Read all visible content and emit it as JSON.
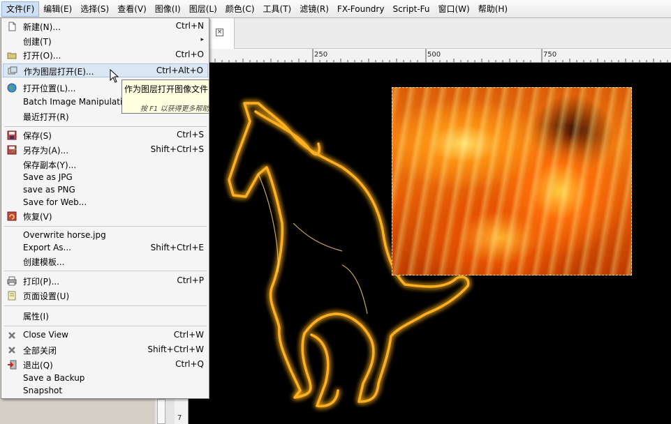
{
  "menubar": {
    "items": [
      {
        "label": "文件(F)"
      },
      {
        "label": "编辑(E)"
      },
      {
        "label": "选择(S)"
      },
      {
        "label": "查看(V)"
      },
      {
        "label": "图像(I)"
      },
      {
        "label": "图层(L)"
      },
      {
        "label": "颜色(C)"
      },
      {
        "label": "工具(T)"
      },
      {
        "label": "滤镜(R)"
      },
      {
        "label": "FX-Foundry"
      },
      {
        "label": "Script-Fu"
      },
      {
        "label": "窗口(W)"
      },
      {
        "label": "帮助(H)"
      }
    ]
  },
  "file_menu": {
    "items": [
      {
        "label": "新建(N)...",
        "shortcut": "Ctrl+N",
        "icon": "new-document-icon"
      },
      {
        "label": "创建(T)",
        "submenu": "▸"
      },
      {
        "label": "打开(O)...",
        "shortcut": "Ctrl+O",
        "icon": "folder-icon"
      },
      {
        "label": "作为图层打开(E)...",
        "shortcut": "Ctrl+Alt+O",
        "icon": "open-as-layer-icon"
      },
      {
        "label": "打开位置(L)...",
        "icon": "globe-icon"
      },
      {
        "label": "Batch Image Manipulation..."
      },
      {
        "label": "最近打开(R)"
      },
      {
        "label": "保存(S)",
        "shortcut": "Ctrl+S",
        "icon": "save-icon"
      },
      {
        "label": "另存为(A)...",
        "shortcut": "Shift+Ctrl+S",
        "icon": "save-as-icon"
      },
      {
        "label": "保存副本(Y)..."
      },
      {
        "label": "Save as JPG"
      },
      {
        "label": "save as PNG"
      },
      {
        "label": "Save for Web..."
      },
      {
        "label": "恢复(V)",
        "icon": "revert-icon"
      },
      {
        "label": "Overwrite horse.jpg"
      },
      {
        "label": "Export As...",
        "shortcut": "Shift+Ctrl+E"
      },
      {
        "label": "创建模板..."
      },
      {
        "label": "打印(P)...",
        "shortcut": "Ctrl+P",
        "icon": "printer-icon"
      },
      {
        "label": "页面设置(U)",
        "icon": "page-setup-icon"
      },
      {
        "label": "属性(I)"
      },
      {
        "label": "Close View",
        "shortcut": "Ctrl+W",
        "icon": "close-x-icon"
      },
      {
        "label": "全部关闭",
        "shortcut": "Shift+Ctrl+W",
        "icon": "close-all-icon"
      },
      {
        "label": "退出(Q)",
        "shortcut": "Ctrl+Q",
        "icon": "quit-icon"
      },
      {
        "label": "Save a Backup"
      },
      {
        "label": "Snapshot"
      }
    ]
  },
  "tooltip": {
    "title": "作为图层打开图像文件",
    "hint": "按 F1 以获得更多帮助"
  },
  "ruler": {
    "ticks": [
      "250",
      "500",
      "750"
    ],
    "vertical_mark": "7"
  },
  "tab": {
    "close_glyph": "×"
  },
  "colors": {
    "menu_highlight": "#dbe6f5",
    "tooltip_bg": "#ffffe1",
    "canvas_bg": "#000000",
    "selection_marching_ants": "#f1e6a0"
  }
}
